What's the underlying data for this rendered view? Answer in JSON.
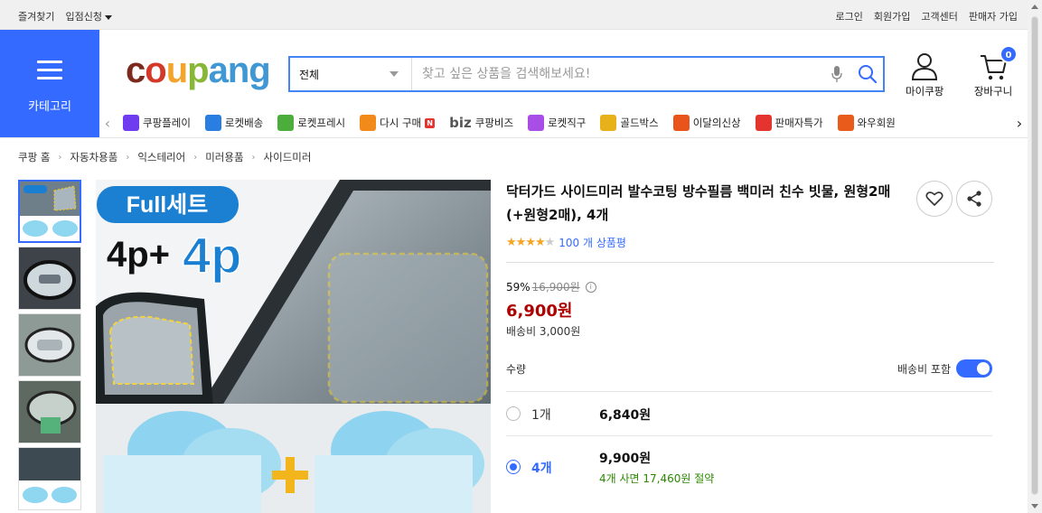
{
  "topbar": {
    "favorites": "즐겨찾기",
    "seller_apply": "입점신청",
    "login": "로그인",
    "signup": "회원가입",
    "customer_center": "고객센터",
    "seller_signup": "판매자 가입"
  },
  "category": {
    "label": "카테고리"
  },
  "logo": {
    "letters": [
      "c",
      "o",
      "u",
      "p",
      "a",
      "n",
      "g"
    ],
    "colors": [
      "#7d2a1e",
      "#d43828",
      "#f2a42c",
      "#88b637",
      "#3f98d4",
      "#3f98d4",
      "#3f98d4"
    ]
  },
  "search": {
    "category_selected": "전체",
    "placeholder": "찾고 싶은 상품을 검색해보세요!"
  },
  "header": {
    "mypage": "마이쿠팡",
    "cart": "장바구니",
    "cart_count": "0"
  },
  "quicknav": {
    "items": [
      {
        "label": "쿠팡플레이",
        "icon": "coupang-play-icon",
        "color": "#6f3cf0"
      },
      {
        "label": "로켓배송",
        "icon": "rocket-delivery-icon",
        "color": "#2a7de1"
      },
      {
        "label": "로켓프레시",
        "icon": "rocket-fresh-icon",
        "color": "#4cae3a"
      },
      {
        "label": "다시 구매",
        "icon": "rebuy-icon",
        "color": "#f28a1a",
        "badge": "N"
      },
      {
        "label": "쿠팡비즈",
        "icon": "biz-icon",
        "color": "#555555",
        "prefix": "biz"
      },
      {
        "label": "로켓직구",
        "icon": "rocket-global-icon",
        "color": "#a84de6"
      },
      {
        "label": "골드박스",
        "icon": "goldbox-icon",
        "color": "#e8b019"
      },
      {
        "label": "이달의신상",
        "icon": "new-arrivals-icon",
        "color": "#e8541a"
      },
      {
        "label": "판매자특가",
        "icon": "seller-deal-icon",
        "color": "#e3342f"
      },
      {
        "label": "와우회원",
        "icon": "wow-icon",
        "color": "#e85b1a"
      }
    ]
  },
  "breadcrumb": [
    "쿠팡 홈",
    "자동차용품",
    "익스테리어",
    "미러용품",
    "사이드미러"
  ],
  "main_image": {
    "headline": "Full세트",
    "subline_left": "4p+",
    "subline_right": "4p",
    "plus": "+"
  },
  "product": {
    "title": "닥터가드 사이드미러 발수코팅 방수필름 백미러 친수 빗물, 원형2매(+원형2매), 4개",
    "rating_filled": 4,
    "rating_total": 5,
    "review_count": "100 개 상품평",
    "discount_rate": "59%",
    "original_price": "16,900원",
    "sale_price": "6,900원",
    "shipping": "배송비 3,000원",
    "qty_label": "수량",
    "shipping_incl_label": "배송비 포함",
    "shipping_incl_on": true,
    "options": [
      {
        "count": "1개",
        "price": "6,840원",
        "selected": false
      },
      {
        "count": "4개",
        "price": "9,900원",
        "saving": "4개 사면 17,460원 절약",
        "selected": true
      }
    ]
  }
}
